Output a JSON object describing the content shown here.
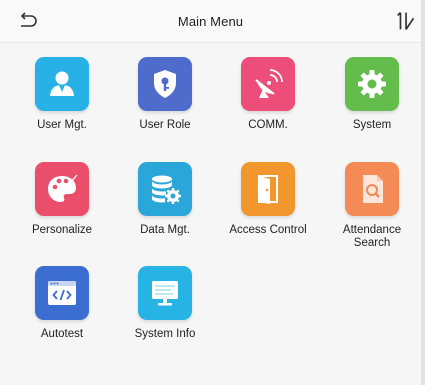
{
  "header": {
    "title": "Main Menu",
    "back_icon": "back-arrow-icon",
    "sort_icon": "sort-icon"
  },
  "menu": {
    "items": [
      {
        "id": "user-mgt",
        "label": "User Mgt.",
        "icon": "user-icon",
        "color": "#27b1e6"
      },
      {
        "id": "user-role",
        "label": "User Role",
        "icon": "shield-key-icon",
        "color": "#4f6ccc"
      },
      {
        "id": "comm",
        "label": "COMM.",
        "icon": "satellite-dish-icon",
        "color": "#ec4d79"
      },
      {
        "id": "system",
        "label": "System",
        "icon": "gear-icon",
        "color": "#63bc4b"
      },
      {
        "id": "personalize",
        "label": "Personalize",
        "icon": "palette-icon",
        "color": "#ea4e6b"
      },
      {
        "id": "data-mgt",
        "label": "Data Mgt.",
        "icon": "database-gear-icon",
        "color": "#2aa6d9"
      },
      {
        "id": "access-control",
        "label": "Access Control",
        "icon": "door-icon",
        "color": "#f2962e"
      },
      {
        "id": "attendance-search",
        "label": "Attendance\nSearch",
        "icon": "document-search-icon",
        "color": "#f48a55"
      },
      {
        "id": "autotest",
        "label": "Autotest",
        "icon": "code-window-icon",
        "color": "#3b6ed0"
      },
      {
        "id": "system-info",
        "label": "System Info",
        "icon": "monitor-icon",
        "color": "#27b3e3"
      }
    ]
  }
}
